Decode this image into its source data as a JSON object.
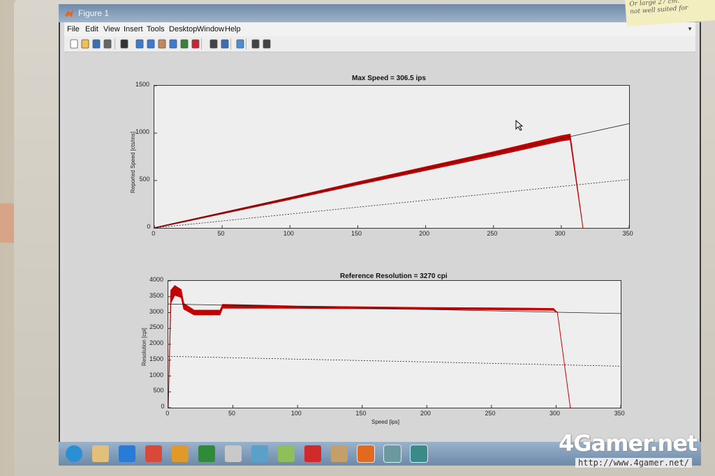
{
  "window": {
    "title": "Figure 1"
  },
  "menu": {
    "items": [
      "File",
      "Edit",
      "View",
      "Insert",
      "Tools",
      "Desktop",
      "Window",
      "Help"
    ]
  },
  "toolbar": {
    "icons": [
      "new-figure-icon",
      "open-file-icon",
      "save-icon",
      "print-icon",
      "edit-plot-icon",
      "zoom-in-icon",
      "zoom-out-icon",
      "pan-icon",
      "rotate-icon",
      "data-cursor-icon",
      "brush-icon",
      "link-plot-icon",
      "colorbar-icon",
      "legend-icon",
      "hide-plot-tools-icon",
      "show-plot-tools-icon"
    ]
  },
  "sticky_note": {
    "lines": [
      "Or large 27 cm.",
      "not well suited for"
    ]
  },
  "watermark": {
    "logo": "4Gamer.net",
    "url": "http://www.4gamer.net/"
  },
  "taskbar": {
    "icons": [
      "start-orb-icon",
      "file-explorer-icon",
      "internet-explorer-icon",
      "chrome-icon",
      "media-icon",
      "excel-icon",
      "notepad-icon",
      "app-icon",
      "notepad-plus-icon",
      "paint-icon",
      "archive-icon",
      "matlab-icon",
      "image-viewer-icon",
      "bus-app-icon"
    ]
  },
  "chart_data": [
    {
      "type": "line",
      "title": "Max Speed = 306.5 ips",
      "xlabel": "",
      "ylabel": "Reported Speed [cts/ms]",
      "xlim": [
        0,
        350
      ],
      "ylim": [
        0,
        1500
      ],
      "xticks": [
        0,
        50,
        100,
        150,
        200,
        250,
        300,
        350
      ],
      "yticks": [
        0,
        500,
        1000,
        1500
      ],
      "grid": false,
      "series": [
        {
          "role": "measured",
          "color": "#cc0000",
          "x": [
            0,
            50,
            100,
            150,
            200,
            250,
            300,
            306.5,
            316
          ],
          "y": [
            0,
            155,
            310,
            470,
            625,
            780,
            945,
            960,
            0
          ],
          "spread": [
            6,
            14,
            22,
            30,
            38,
            46,
            56,
            60,
            0
          ]
        },
        {
          "role": "reference-solid",
          "color": "#222222",
          "x": [
            0,
            350
          ],
          "y": [
            0,
            1100
          ]
        },
        {
          "role": "reference-dashed",
          "color": "#222222",
          "x": [
            0,
            350
          ],
          "y": [
            0,
            510
          ]
        }
      ]
    },
    {
      "type": "line",
      "title": "Reference Resolution = 3270 cpi",
      "xlabel": "Speed [ips]",
      "ylabel": "Resolution [cpi]",
      "xlim": [
        0,
        350
      ],
      "ylim": [
        0,
        4000
      ],
      "xticks": [
        0,
        50,
        100,
        150,
        200,
        250,
        300,
        350
      ],
      "yticks": [
        0,
        500,
        1000,
        1500,
        2000,
        2500,
        3000,
        3500,
        4000
      ],
      "grid": false,
      "series": [
        {
          "role": "measured",
          "color": "#cc0000",
          "x": [
            0,
            2,
            5,
            10,
            12,
            20,
            30,
            40,
            42,
            100,
            150,
            200,
            250,
            298,
            301,
            311
          ],
          "y": [
            0,
            3500,
            3700,
            3600,
            3200,
            3000,
            3000,
            3000,
            3200,
            3170,
            3150,
            3130,
            3120,
            3100,
            3000,
            0
          ],
          "spread": [
            0,
            400,
            300,
            250,
            180,
            150,
            150,
            150,
            120,
            70,
            60,
            60,
            60,
            60,
            0,
            0
          ]
        },
        {
          "role": "reference-solid",
          "color": "#222222",
          "x": [
            0,
            350
          ],
          "y": [
            3270,
            2970
          ]
        },
        {
          "role": "reference-dashed",
          "color": "#222222",
          "x": [
            0,
            350
          ],
          "y": [
            1620,
            1310
          ]
        }
      ]
    }
  ]
}
